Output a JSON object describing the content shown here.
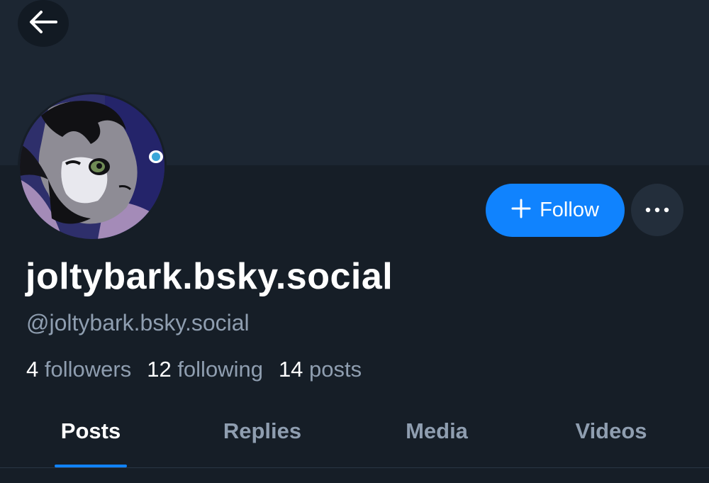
{
  "profile": {
    "display_name": "joltybark.bsky.social",
    "handle": "@joltybark.bsky.social",
    "avatar_icon": "fox-avatar-image"
  },
  "actions": {
    "back_icon": "arrow-left-icon",
    "follow_label": "Follow",
    "follow_icon": "plus-icon",
    "more_icon": "ellipsis-icon"
  },
  "stats": {
    "followers": {
      "count": "4",
      "label": "followers"
    },
    "following": {
      "count": "12",
      "label": "following"
    },
    "posts": {
      "count": "14",
      "label": "posts"
    }
  },
  "tabs": [
    {
      "label": "Posts",
      "active": true
    },
    {
      "label": "Replies",
      "active": false
    },
    {
      "label": "Media",
      "active": false
    },
    {
      "label": "Videos",
      "active": false
    }
  ],
  "colors": {
    "accent": "#1083fe",
    "background": "#161e27",
    "banner": "#1c2632",
    "muted_text": "#8f9eb0"
  }
}
